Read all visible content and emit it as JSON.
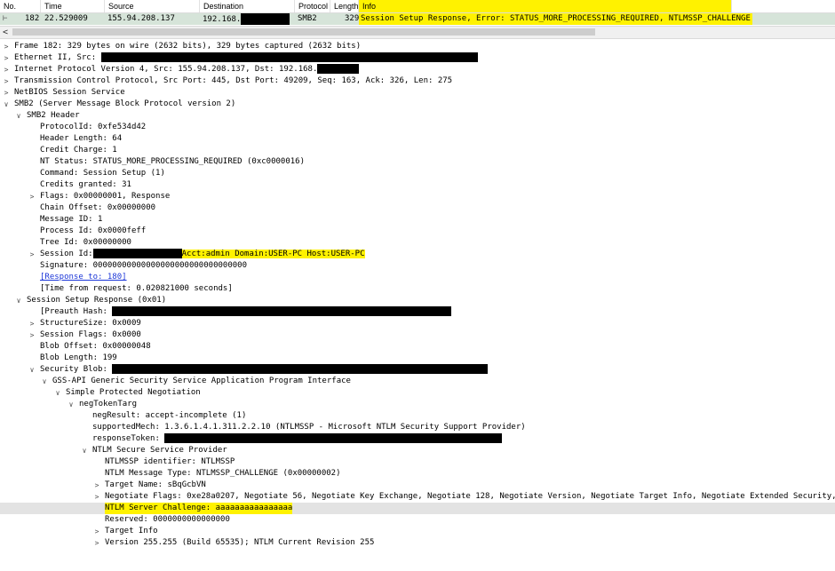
{
  "columns": {
    "no": "No.",
    "time": "Time",
    "source": "Source",
    "destination": "Destination",
    "protocol": "Protocol",
    "length": "Length",
    "info": "Info"
  },
  "packet": {
    "no": "182",
    "time": "22.529009",
    "source": "155.94.208.137",
    "destination": "192.168.",
    "protocol": "SMB2",
    "length": "329",
    "info": "Session Setup Response, Error: STATUS_MORE_PROCESSING_REQUIRED, NTLMSSP_CHALLENGE"
  },
  "scroll_arrow": "<",
  "details": {
    "frame": "Frame 182: 329 bytes on wire (2632 bits), 329 bytes captured (2632 bits)",
    "ethernet": "Ethernet II, Src:",
    "ip": "Internet Protocol Version 4, Src: 155.94.208.137, Dst: 192.168.",
    "tcp": "Transmission Control Protocol, Src Port: 445, Dst Port: 49209, Seq: 163, Ack: 326, Len: 275",
    "netbios": "NetBIOS Session Service",
    "smb2": "SMB2 (Server Message Block Protocol version 2)",
    "smb2_header": "SMB2 Header",
    "protocol_id": "ProtocolId: 0xfe534d42",
    "header_length": "Header Length: 64",
    "credit_charge": "Credit Charge: 1",
    "nt_status": "NT Status: STATUS_MORE_PROCESSING_REQUIRED (0xc0000016)",
    "command": "Command: Session Setup (1)",
    "credits_granted": "Credits granted: 31",
    "flags": "Flags: 0x00000001, Response",
    "chain_offset": "Chain Offset: 0x00000000",
    "message_id": "Message ID: 1",
    "process_id": "Process Id: 0x0000feff",
    "tree_id": "Tree Id: 0x00000000",
    "session_id": "Session Id:",
    "session_id_hl": "Acct:admin Domain:USER-PC Host:USER-PC",
    "signature": "Signature: 00000000000000000000000000000000",
    "response_to": "[Response to: 180]",
    "time_from_request": "[Time from request: 0.020821000 seconds]",
    "session_setup_response": "Session Setup Response (0x01)",
    "preauth_hash": "[Preauth Hash:",
    "structure_size": "StructureSize: 0x0009",
    "session_flags": "Session Flags: 0x0000",
    "blob_offset": "Blob Offset: 0x00000048",
    "blob_length": "Blob Length: 199",
    "security_blob": "Security Blob:",
    "gss_api": "GSS-API Generic Security Service Application Program Interface",
    "spnego": "Simple Protected Negotiation",
    "neg_token_targ": "negTokenTarg",
    "neg_result": "negResult: accept-incomplete (1)",
    "supported_mech": "supportedMech: 1.3.6.1.4.1.311.2.2.10 (NTLMSSP - Microsoft NTLM Security Support Provider)",
    "response_token": "responseToken:",
    "ntlm_ssp": "NTLM Secure Service Provider",
    "ntlmssp_id": "NTLMSSP identifier: NTLMSSP",
    "ntlm_msg_type": "NTLM Message Type: NTLMSSP_CHALLENGE (0x00000002)",
    "target_name": "Target Name: sBqGcbVN",
    "negotiate_flags": "Negotiate Flags: 0xe28a0207, Negotiate 56, Negotiate Key Exchange, Negotiate 128, Negotiate Version, Negotiate Target Info, Negotiate Extended Security, Target",
    "server_challenge": "NTLM Server Challenge: aaaaaaaaaaaaaaaa",
    "reserved": "Reserved: 0000000000000000",
    "target_info": "Target Info",
    "version": "Version 255.255 (Build 65535); NTLM Current Revision 255"
  },
  "colors": {
    "highlight": "#fff200",
    "selected_row": "#d6e4d9",
    "link": "#1a35d8"
  }
}
